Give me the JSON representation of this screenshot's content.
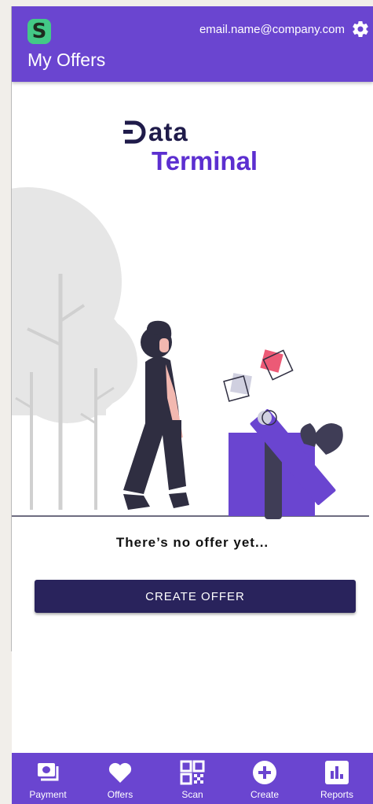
{
  "header": {
    "logo_letter": "S",
    "title": "My Offers",
    "email": "email.name@company.com",
    "settings_icon": "gear-icon"
  },
  "brand": {
    "line1": "ata",
    "line2": "Terminal"
  },
  "empty_state": {
    "message": "There’s no offer yet...",
    "button_label": "CREATE OFFER"
  },
  "bottom_nav": {
    "items": [
      {
        "label": "Payment",
        "icon": "payment-icon"
      },
      {
        "label": "Offers",
        "icon": "heart-icon"
      },
      {
        "label": "Scan",
        "icon": "qr-code-icon"
      },
      {
        "label": "Create",
        "icon": "plus-circle-icon"
      },
      {
        "label": "Reports",
        "icon": "bar-chart-icon"
      }
    ]
  },
  "colors": {
    "primary": "#6a45d0",
    "button": "#29235c",
    "logo": "#43c987",
    "brand_dark": "#1f1b4a",
    "brand_purple": "#5c2fd0"
  }
}
